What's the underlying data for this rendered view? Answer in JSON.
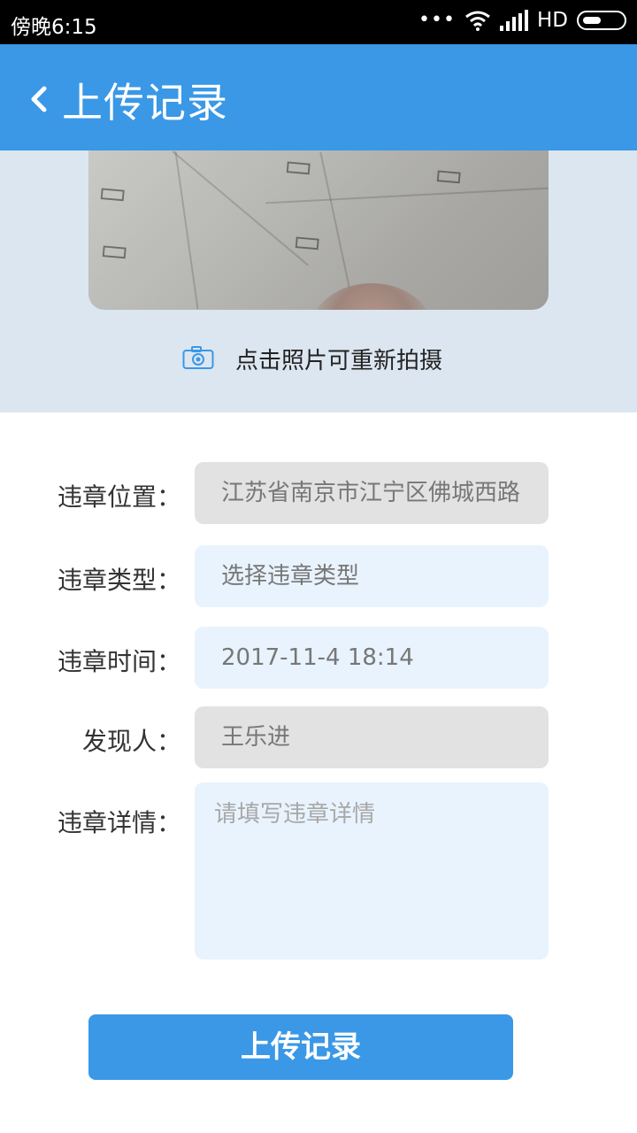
{
  "status_bar": {
    "time": "傍晚6:15",
    "network": "HD"
  },
  "app_bar": {
    "title": "上传记录"
  },
  "photo": {
    "hint": "点击照片可重新拍摄"
  },
  "form": {
    "location": {
      "label": "违章位置：",
      "value": "江苏省南京市江宁区佛城西路"
    },
    "type": {
      "label": "违章类型：",
      "value": "选择违章类型"
    },
    "time": {
      "label": "违章时间：",
      "value": "2017-11-4 18:14"
    },
    "finder": {
      "label": "发现人：",
      "value": "王乐进"
    },
    "details": {
      "label": "违章详情：",
      "placeholder": "请填写违章详情"
    }
  },
  "submit": {
    "label": "上传记录"
  },
  "colors": {
    "primary": "#3a98e6",
    "photo_bg": "#dce6f0",
    "field_blue": "#e8f3fd",
    "field_gray": "#e2e2e2"
  }
}
